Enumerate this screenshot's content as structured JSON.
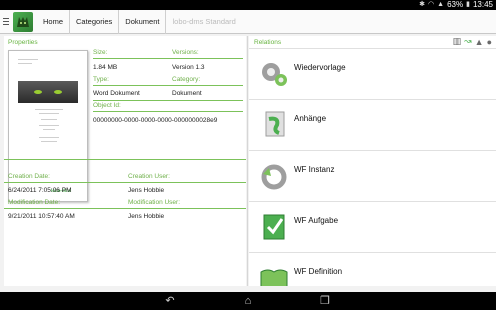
{
  "status_bar": {
    "battery_percent": "63%",
    "time": "13:45"
  },
  "breadcrumb": {
    "items": [
      "Home",
      "Categories",
      "Dokument",
      "lobo-dms Standard"
    ]
  },
  "properties": {
    "title": "Properties",
    "size_label": "Size:",
    "size_value": "1.84 MB",
    "versions_label": "Versions:",
    "versions_value": "Version 1.3",
    "type_label": "Type:",
    "type_value": "Word Dokument",
    "category_label": "Category:",
    "category_value": "Dokument",
    "object_id_label": "Object Id:",
    "object_id_value": "00000000-0000-0000-0000-0000000028e9",
    "creation_date_label": "Creation Date:",
    "creation_date_value": "6/24/2011 7:05:06 PM",
    "creation_user_label": "Creation User:",
    "creation_user_value": "Jens Hobbie",
    "modification_date_label": "Modification Date:",
    "modification_date_value": "9/21/2011 10:57:40 AM",
    "modification_user_label": "Modification User:",
    "modification_user_value": "Jens Hobbie",
    "thumbnail_brand": "lobo-dms"
  },
  "relations": {
    "title": "Relations",
    "toolbar_icons": [
      "book-icon",
      "workflow-icon",
      "mountain-icon",
      "speech-bubble-icon"
    ],
    "items": [
      {
        "label": "Wiedervorlage",
        "icon": "gears-icon"
      },
      {
        "label": "Anhänge",
        "icon": "attachment-icon"
      },
      {
        "label": "WF Instanz",
        "icon": "refresh-icon"
      },
      {
        "label": "WF Aufgabe",
        "icon": "checklist-icon"
      },
      {
        "label": "WF Definition",
        "icon": "open-book-icon"
      }
    ]
  },
  "colors": {
    "accent_green": "#69b443",
    "status_bar": "#000000"
  }
}
